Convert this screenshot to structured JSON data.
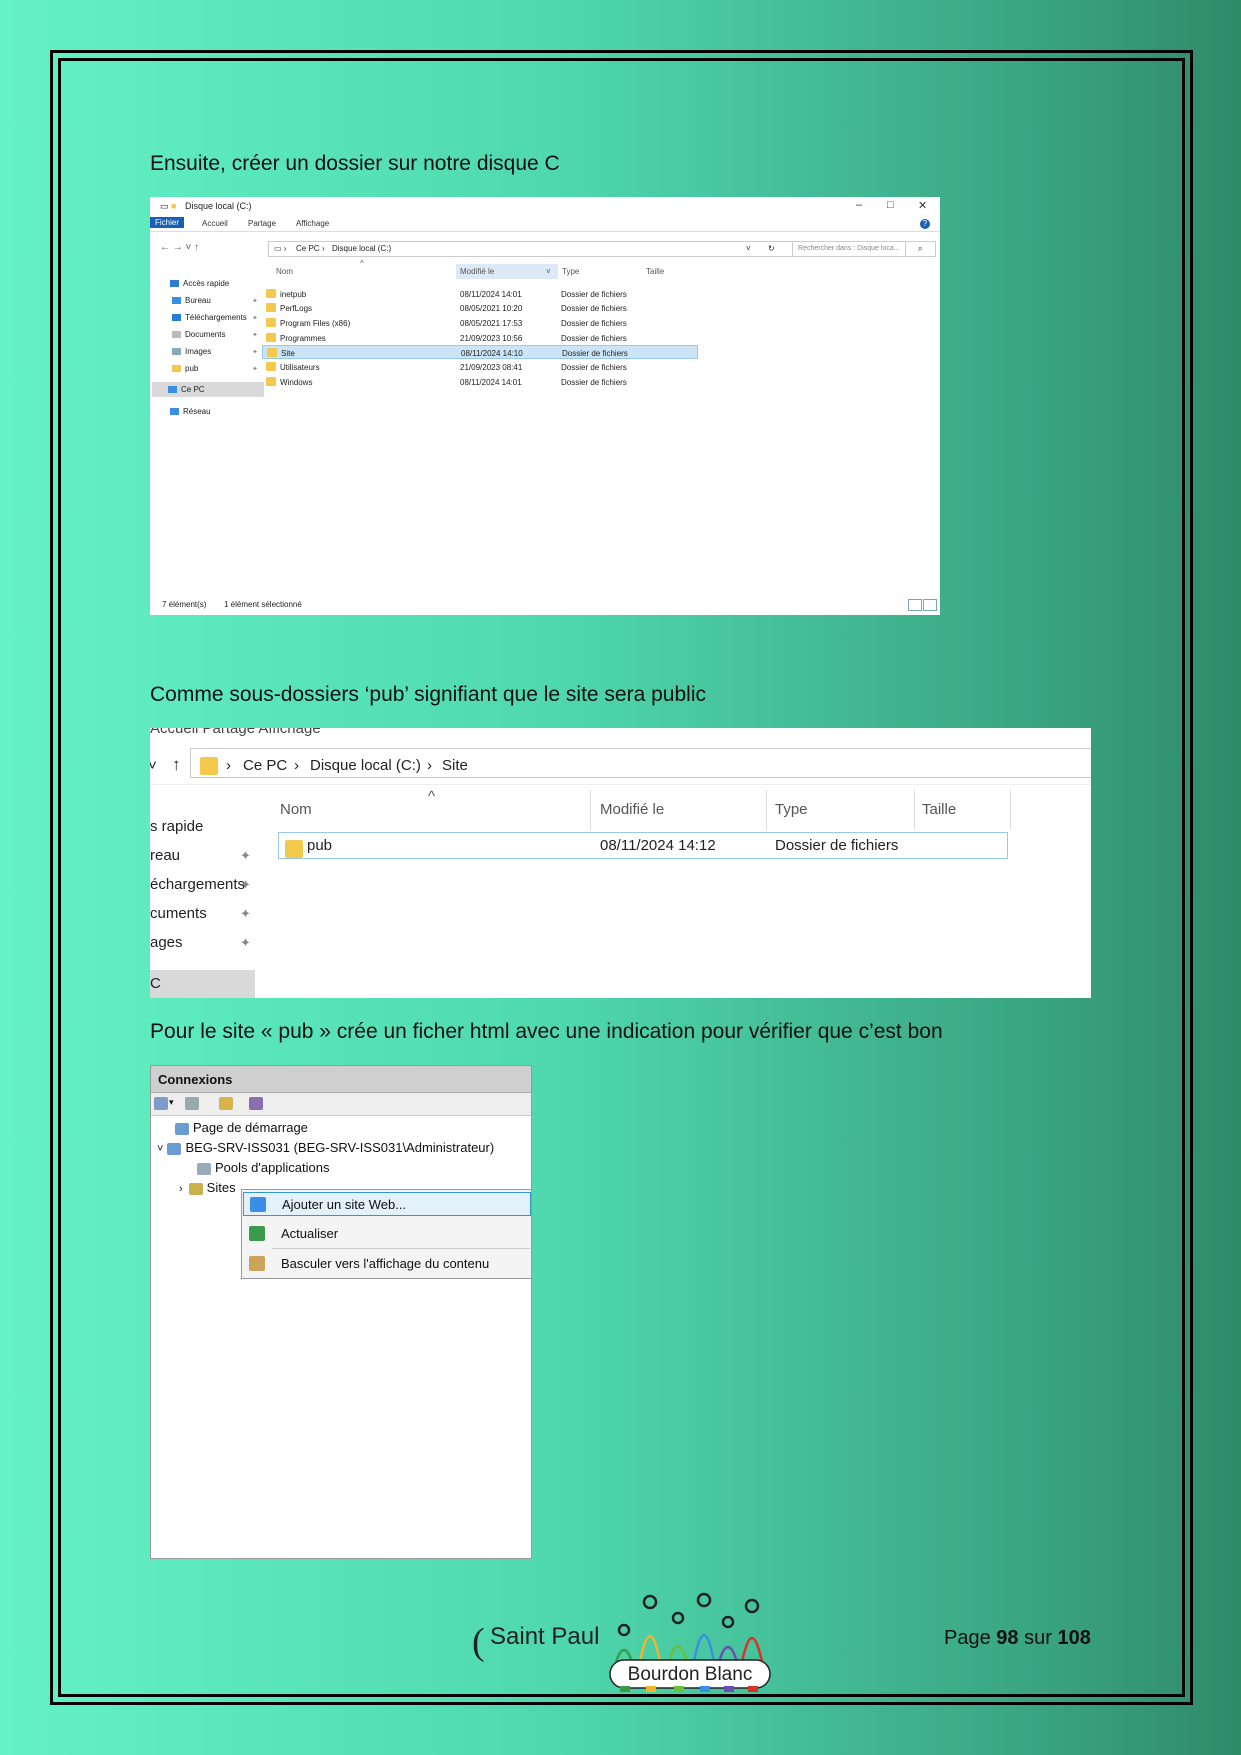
{
  "captions": {
    "c1": "Ensuite, créer un dossier sur notre disque C",
    "c2": "Comme sous-dossiers ‘pub’ signifiant que le site sera public",
    "c3": "Pour le site « pub » crée un ficher html avec une indication pour vérifier que c’est bon"
  },
  "explorer1": {
    "title": "Disque local (C:)",
    "ribbon": [
      "Fichier",
      "Accueil",
      "Partage",
      "Affichage"
    ],
    "breadcrumb": [
      "Ce PC",
      "Disque local (C:)"
    ],
    "search_placeholder": "Rechercher dans : Disque loca...",
    "sidebar": [
      "Accès rapide",
      "Bureau",
      "Téléchargements",
      "Documents",
      "Images",
      "pub",
      "Ce PC",
      "Réseau"
    ],
    "columns": [
      "Nom",
      "Modifié le",
      "Type",
      "Taille"
    ],
    "rows": [
      {
        "name": "inetpub",
        "date": "08/11/2024 14:01",
        "type": "Dossier de fichiers"
      },
      {
        "name": "PerfLogs",
        "date": "08/05/2021 10:20",
        "type": "Dossier de fichiers"
      },
      {
        "name": "Program Files (x86)",
        "date": "08/05/2021 17:53",
        "type": "Dossier de fichiers"
      },
      {
        "name": "Programmes",
        "date": "21/09/2023 10:56",
        "type": "Dossier de fichiers"
      },
      {
        "name": "Site",
        "date": "08/11/2024 14:10",
        "type": "Dossier de fichiers"
      },
      {
        "name": "Utilisateurs",
        "date": "21/09/2023 08:41",
        "type": "Dossier de fichiers"
      },
      {
        "name": "Windows",
        "date": "08/11/2024 14:01",
        "type": "Dossier de fichiers"
      }
    ],
    "status_count": "7 élément(s)",
    "status_selected": "1 élément sélectionné"
  },
  "explorer2": {
    "topcut": "Accueil      Partage      Affichage",
    "breadcrumb": [
      "Ce PC",
      "Disque local (C:)",
      "Site"
    ],
    "columns": [
      "Nom",
      "Modifié le",
      "Type",
      "Taille"
    ],
    "row": {
      "name": "pub",
      "date": "08/11/2024 14:12",
      "type": "Dossier de fichiers"
    },
    "sidebar": [
      "s rapide",
      "reau",
      "échargements",
      "cuments",
      "ages",
      "C"
    ]
  },
  "iis": {
    "header": "Connexions",
    "nodes": {
      "start": "Page de démarrage",
      "server": "BEG-SRV-ISS031 (BEG-SRV-ISS031\\Administrateur)",
      "pools": "Pools d'applications",
      "sites": "Sites"
    },
    "menu": [
      "Ajouter un site Web...",
      "Actualiser",
      "Basculer vers l'affichage du contenu"
    ]
  },
  "footer": {
    "brand": "Saint Paul",
    "logo_text": "Bourdon Blanc",
    "page_label": "Page",
    "page_current": "98",
    "page_sep": "sur",
    "page_total": "108"
  },
  "colors": {
    "accent": "#1a5fb4",
    "folder": "#f3c94d",
    "selection": "#cce4f7"
  }
}
